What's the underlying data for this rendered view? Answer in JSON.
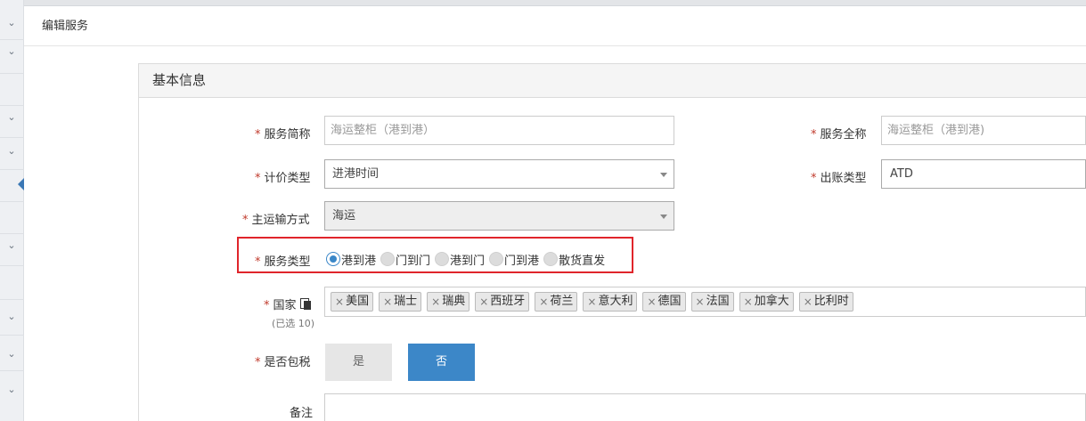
{
  "modal": {
    "title": "编辑服务"
  },
  "panel": {
    "heading": "基本信息"
  },
  "required_mark": "*",
  "fields": {
    "short_name": {
      "label": "服务简称",
      "placeholder": "海运整柜（港到港）"
    },
    "full_name": {
      "label": "服务全称",
      "placeholder": "海运整柜（港到港)"
    },
    "pricing_type": {
      "label": "计价类型",
      "value": "进港时间"
    },
    "billing_type": {
      "label": "出账类型",
      "value": "ATD"
    },
    "transport_mode": {
      "label": "主运输方式",
      "value": "海运"
    },
    "service_type": {
      "label": "服务类型",
      "options": [
        "港到港",
        "门到门",
        "港到门",
        "门到港",
        "散货直发"
      ],
      "selected": "港到港"
    },
    "country": {
      "label": "国家",
      "selected_count_text": "(已选 10)",
      "remove_symbol": "×",
      "tags": [
        "美国",
        "瑞士",
        "瑞典",
        "西班牙",
        "荷兰",
        "意大利",
        "德国",
        "法国",
        "加拿大",
        "比利时"
      ]
    },
    "tax_included": {
      "label": "是否包税",
      "yes": "是",
      "no": "否",
      "selected": "否"
    },
    "remark": {
      "label": "备注"
    }
  },
  "colors": {
    "accent": "#3c87c8",
    "required": "#c0392b",
    "highlight_box": "#e0252b"
  }
}
